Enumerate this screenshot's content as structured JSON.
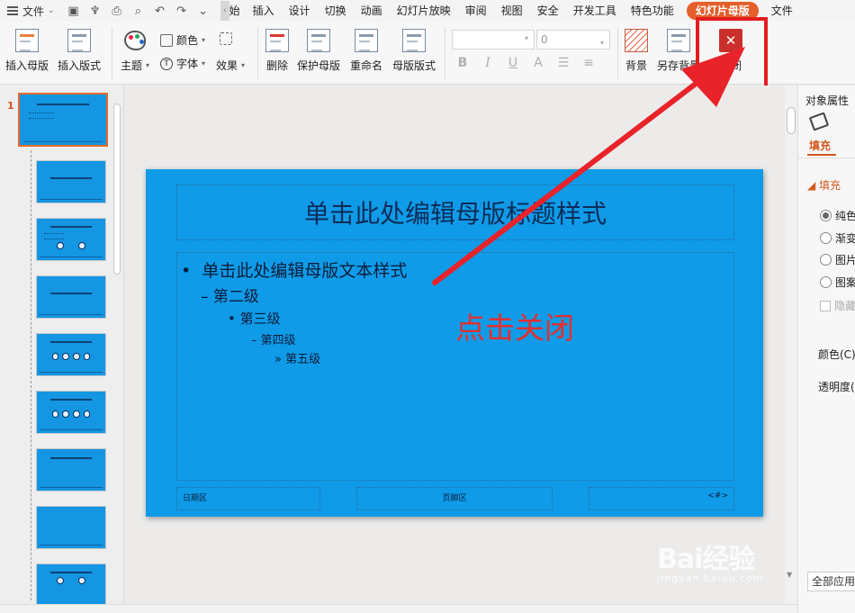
{
  "titlebar": {
    "file_menu": "文件",
    "tabs": [
      {
        "label": "插入"
      },
      {
        "label": "设计"
      },
      {
        "label": "切换"
      },
      {
        "label": "动画"
      },
      {
        "label": "幻灯片放映"
      },
      {
        "label": "审阅"
      },
      {
        "label": "视图"
      },
      {
        "label": "安全"
      },
      {
        "label": "开发工具"
      },
      {
        "label": "特色功能"
      },
      {
        "label": "幻灯片母版",
        "active": true
      },
      {
        "label": "文件"
      }
    ]
  },
  "ribbon": {
    "insert_master": "插入母版",
    "insert_layout": "插入版式",
    "theme": "主题",
    "colors": "颜色",
    "fonts": "字体",
    "effects": "效果",
    "delete": "删除",
    "protect_master": "保护母版",
    "rename": "重命名",
    "master_layout": "母版版式",
    "font_size_value": "0",
    "background": "背景",
    "save_background": "另存背景",
    "close": "关闭",
    "format_buttons": [
      "B",
      "I",
      "U",
      "A"
    ]
  },
  "thumbnails": {
    "selected_number": "1",
    "count": 9
  },
  "slide": {
    "title": "单击此处编辑母版标题样式",
    "levels": [
      "单击此处编辑母版文本样式",
      "第二级",
      "第三级",
      "第四级",
      "第五级"
    ],
    "bullets": [
      "•",
      "–",
      "•",
      "–",
      "»"
    ],
    "footer_date": "日期区",
    "footer_center": "页脚区",
    "footer_number": "<#>",
    "background_color": "#0f9be8"
  },
  "annotation": {
    "text": "点击关闭",
    "color": "#e23030"
  },
  "properties": {
    "title": "对象属性",
    "tab_fill": "填充",
    "section_fill": "填充",
    "options": [
      "纯色",
      "渐变",
      "图片",
      "图案"
    ],
    "selected_option": "纯色",
    "hide_bg": "隐藏",
    "color_label": "颜色(C)",
    "transparency_label": "透明度(",
    "apply_all": "全部应用"
  },
  "watermark": {
    "brand": "Bai经验",
    "url": "jingyan.baidu.com"
  }
}
